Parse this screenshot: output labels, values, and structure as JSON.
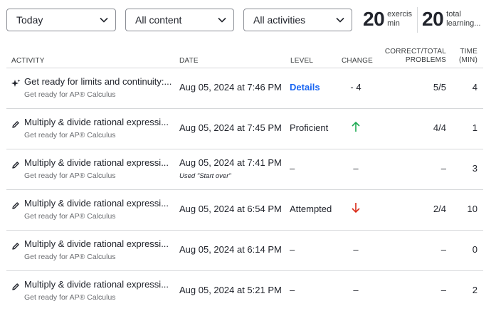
{
  "filters": {
    "time": "Today",
    "content": "All content",
    "activities": "All activities"
  },
  "stats": [
    {
      "value": "20",
      "label_line1": "exercis",
      "label_line2": "min"
    },
    {
      "value": "20",
      "label_line1": "total",
      "label_line2": "learning..."
    }
  ],
  "table": {
    "headers": {
      "activity": "Activity",
      "date": "Date",
      "level": "Level",
      "change": "Change",
      "correct_line1": "Correct/Total",
      "correct_line2": "Problems",
      "time_line1": "Time",
      "time_line2": "(min)"
    },
    "rows": [
      {
        "icon": "sparkle-icon",
        "title": "Get ready for limits and continuity:...",
        "course": "Get ready for AP® Calculus",
        "date": "Aug 05, 2024 at 7:46 PM",
        "note": "",
        "level": "Details",
        "change": "- 4",
        "change_dir": "none",
        "correct": "5/5",
        "time": "4"
      },
      {
        "icon": "pencil-icon",
        "title": "Multiply & divide rational expressi...",
        "course": "Get ready for AP® Calculus",
        "date": "Aug 05, 2024 at 7:45 PM",
        "note": "",
        "level": "Proficient",
        "change": "",
        "change_dir": "up",
        "correct": "4/4",
        "time": "1"
      },
      {
        "icon": "pencil-icon",
        "title": "Multiply & divide rational expressi...",
        "course": "Get ready for AP® Calculus",
        "date": "Aug 05, 2024 at 7:41 PM",
        "note": "Used \"Start over\"",
        "level": "–",
        "change": "–",
        "change_dir": "none",
        "correct": "–",
        "time": "3"
      },
      {
        "icon": "pencil-icon",
        "title": "Multiply & divide rational expressi...",
        "course": "Get ready for AP® Calculus",
        "date": "Aug 05, 2024 at 6:54 PM",
        "note": "",
        "level": "Attempted",
        "change": "",
        "change_dir": "down",
        "correct": "2/4",
        "time": "10"
      },
      {
        "icon": "pencil-icon",
        "title": "Multiply & divide rational expressi...",
        "course": "Get ready for AP® Calculus",
        "date": "Aug 05, 2024 at 6:14 PM",
        "note": "",
        "level": "–",
        "change": "–",
        "change_dir": "none",
        "correct": "–",
        "time": "0"
      },
      {
        "icon": "pencil-icon",
        "title": "Multiply & divide rational expressi...",
        "course": "Get ready for AP® Calculus",
        "date": "Aug 05, 2024 at 5:21 PM",
        "note": "",
        "level": "–",
        "change": "–",
        "change_dir": "none",
        "correct": "–",
        "time": "2"
      }
    ]
  },
  "colors": {
    "link": "#1865f2",
    "up": "#1fab54",
    "down": "#d92916"
  }
}
